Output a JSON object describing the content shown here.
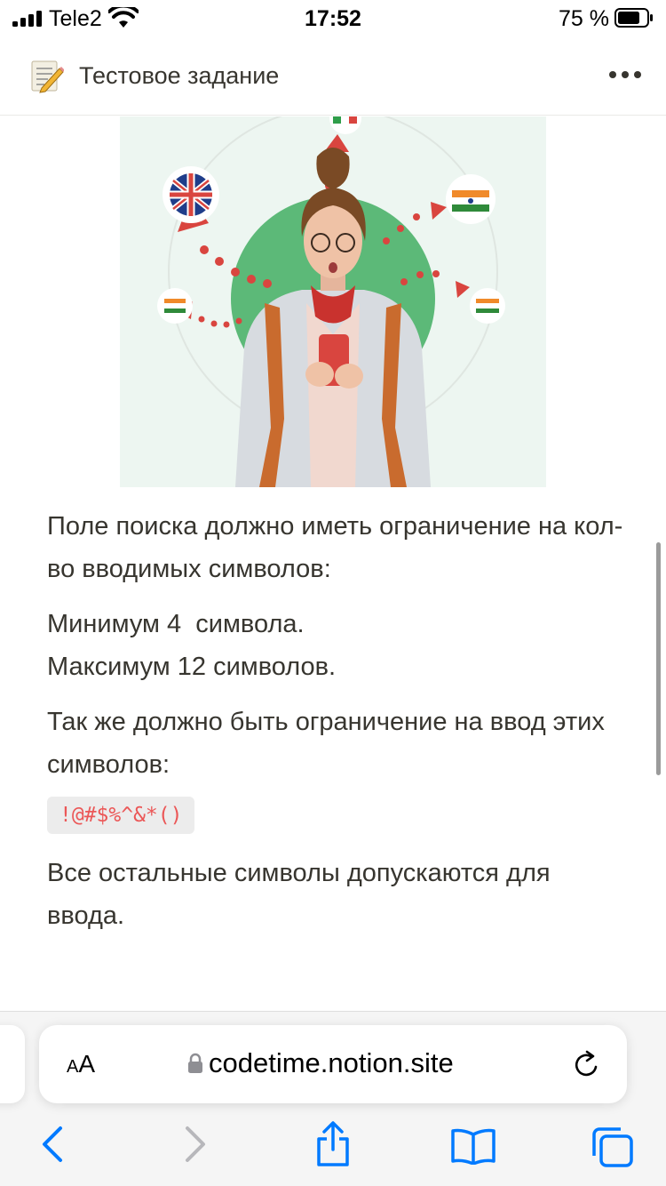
{
  "status_bar": {
    "carrier": "Tele2",
    "time": "17:52",
    "battery": "75 %"
  },
  "header": {
    "page_icon": "memo-pencil-icon",
    "title": "Тестовое задание",
    "more_icon": "more-horizontal-icon"
  },
  "hero": {
    "image": "woman-with-phone-flags-illustration",
    "flags": [
      "italy-flag-icon",
      "uk-flag-icon",
      "india-flag-icon",
      "india-flag-icon",
      "india-flag-icon"
    ]
  },
  "content": {
    "para1": "Поле поиска должно иметь ограничение на кол-во вводимых символов:",
    "min_line": "Минимум 4  символа.",
    "max_line": "Максимум 12 символов.",
    "para3": "Так же должно быть ограничение на ввод этих символов:",
    "code": "!@#$%^&*()",
    "para4": "Все остальные символы допускаются для ввода."
  },
  "safari": {
    "text_size_button": "AA",
    "url": "codetime.notion.site",
    "lock_icon": "lock-icon",
    "reload_icon": "reload-icon",
    "toolbar": [
      "back-icon",
      "forward-icon",
      "share-icon",
      "bookmarks-icon",
      "tabs-icon"
    ]
  },
  "colors": {
    "accent_blue": "#007aff",
    "code_red": "#eb5757",
    "text": "#37352f",
    "hero_green": "#5cb978",
    "dot_red": "#d9453f"
  }
}
